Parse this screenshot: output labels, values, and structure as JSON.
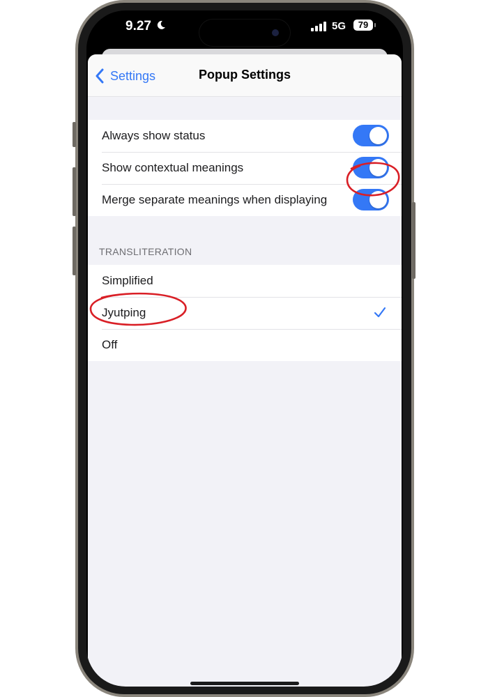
{
  "status_bar": {
    "time": "9.27",
    "network": "5G",
    "battery": "79",
    "icons": [
      "moon-icon",
      "signal-bars-icon"
    ]
  },
  "nav": {
    "back_label": "Settings",
    "title": "Popup Settings"
  },
  "toggles": [
    {
      "label": "Always show status",
      "on": true
    },
    {
      "label": "Show contextual meanings",
      "on": true
    },
    {
      "label": "Merge separate meanings when displaying",
      "on": true
    }
  ],
  "transliteration": {
    "header": "TRANSLITERATION",
    "options": [
      {
        "label": "Simplified",
        "selected": false
      },
      {
        "label": "Jyutping",
        "selected": true
      },
      {
        "label": "Off",
        "selected": false
      }
    ]
  },
  "colors": {
    "accent": "#3478f6",
    "annotation": "#d91f26",
    "background": "#f2f2f7"
  }
}
